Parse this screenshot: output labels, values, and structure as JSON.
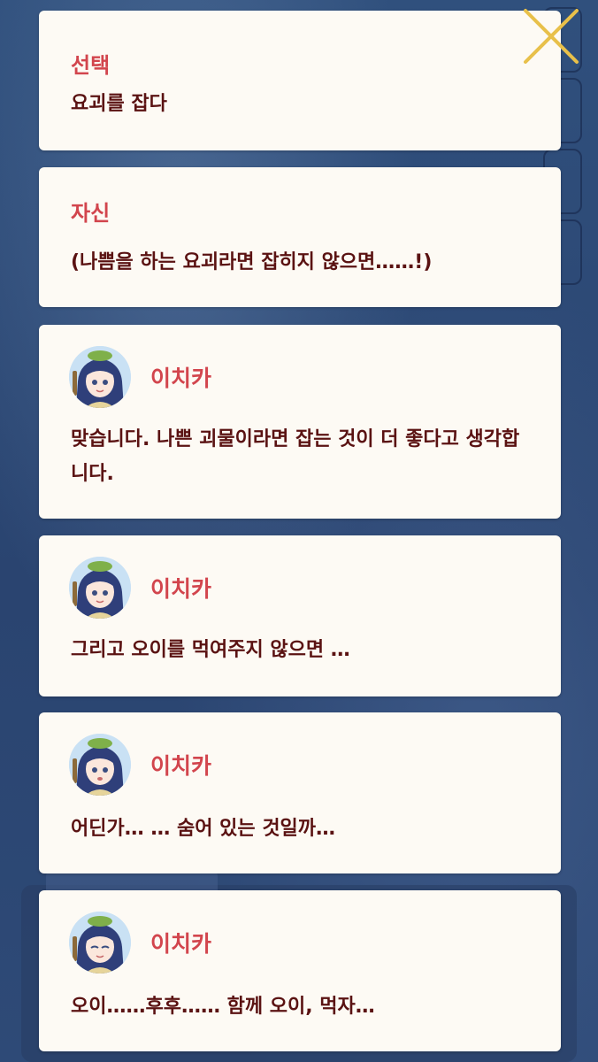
{
  "colors": {
    "card_bg": "#fdfaf4",
    "title_red": "#d2454d",
    "text_brown": "#5a1212",
    "background_blue": "#2b4673",
    "close_gold": "#e8c04a"
  },
  "close_button": {
    "icon": "close-icon"
  },
  "cards": [
    {
      "type": "label",
      "title": "선택",
      "text": "요괴를 잡다"
    },
    {
      "type": "label",
      "title": "자신",
      "text": "(나쁨을 하는 요괴라면 잡히지 않으면……!)"
    },
    {
      "type": "dialogue",
      "avatar": "ichika-avatar",
      "speaker": "이치카",
      "text": "맞습니다. 나쁜 괴물이라면 잡는 것이 더 좋다고 생각합니다."
    },
    {
      "type": "dialogue",
      "avatar": "ichika-avatar",
      "speaker": "이치카",
      "text": "그리고 오이를 먹여주지 않으면 …"
    },
    {
      "type": "dialogue",
      "avatar": "ichika-avatar",
      "speaker": "이치카",
      "text": "어딘가… … 숨어 있는 것일까…"
    },
    {
      "type": "dialogue",
      "avatar": "ichika-avatar",
      "speaker": "이치카",
      "text": "오이……후후…… 함께 오이, 먹자…"
    }
  ],
  "background_hint": "자신"
}
